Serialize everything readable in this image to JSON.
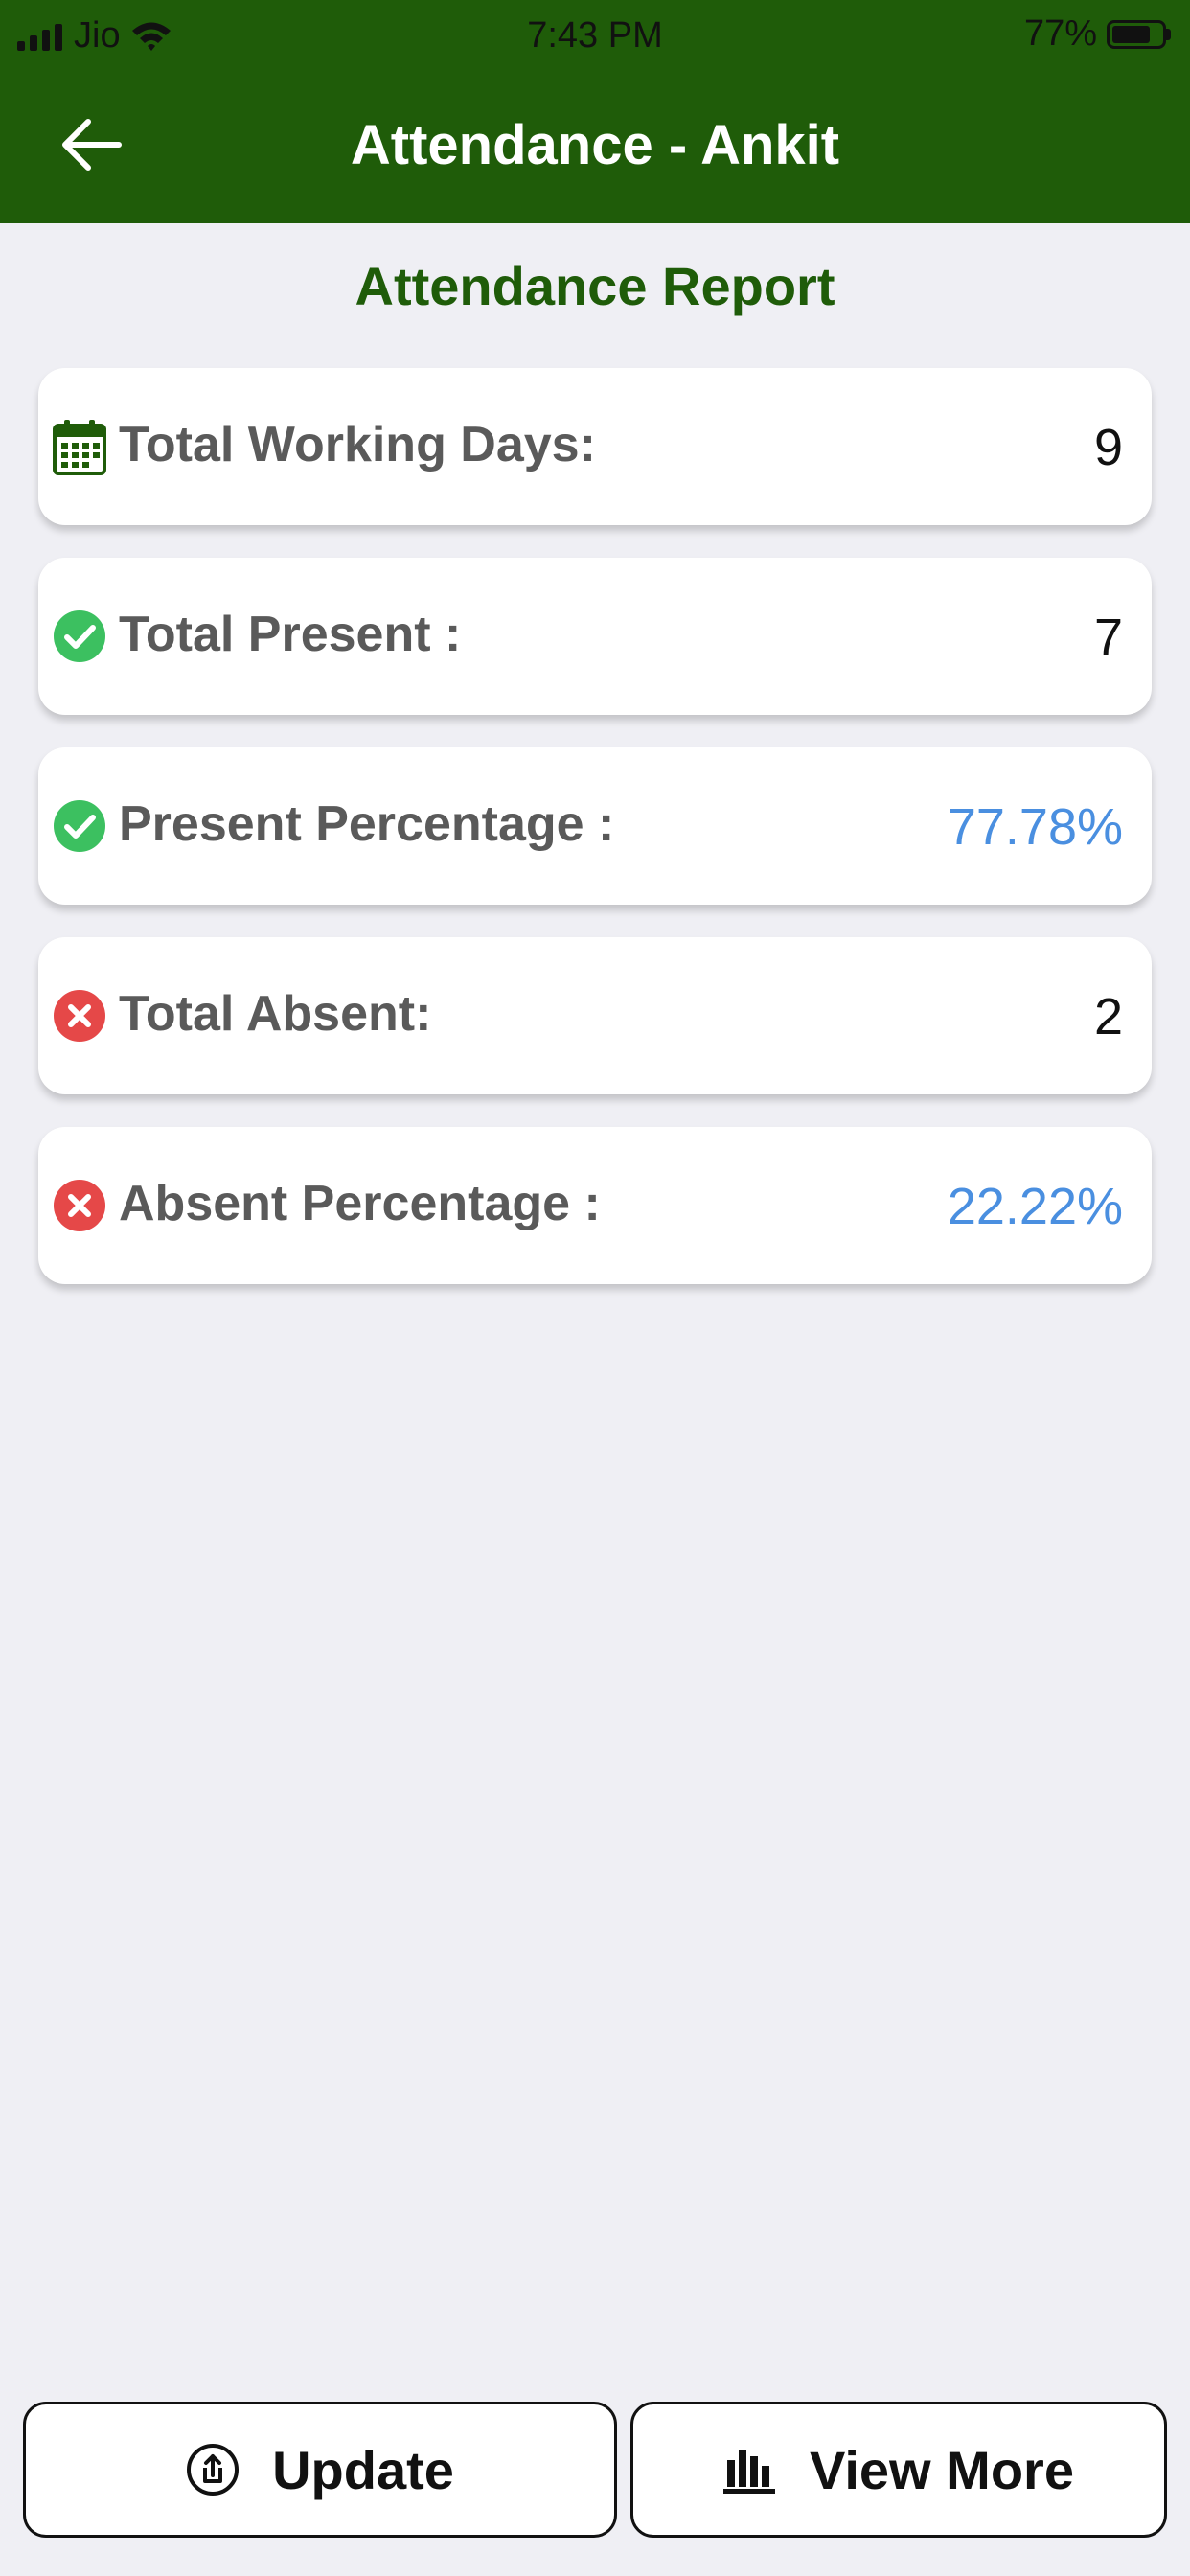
{
  "status_bar": {
    "carrier": "Jio",
    "time": "7:43 PM",
    "battery": "77%",
    "battery_level": 0.77
  },
  "header": {
    "title": "Attendance - Ankit"
  },
  "report": {
    "title": "Attendance Report",
    "rows": [
      {
        "label": "Total Working Days:",
        "value": "9",
        "icon": "calendar-icon"
      },
      {
        "label": "Total Present :",
        "value": "7",
        "icon": "check-circle-icon"
      },
      {
        "label": "Present Percentage :",
        "value": "77.78%",
        "icon": "check-circle-icon"
      },
      {
        "label": "Total Absent:",
        "value": "2",
        "icon": "x-circle-icon"
      },
      {
        "label": "Absent Percentage :",
        "value": "22.22%",
        "icon": "x-circle-icon"
      }
    ]
  },
  "actions": {
    "update_label": "Update",
    "view_more_label": "View More"
  },
  "colors": {
    "header_bg": "#1f5c09",
    "accent_green": "#1f5c09",
    "value_blue": "#4a8fe0",
    "present_green": "#3cc060",
    "absent_red": "#e54848"
  }
}
